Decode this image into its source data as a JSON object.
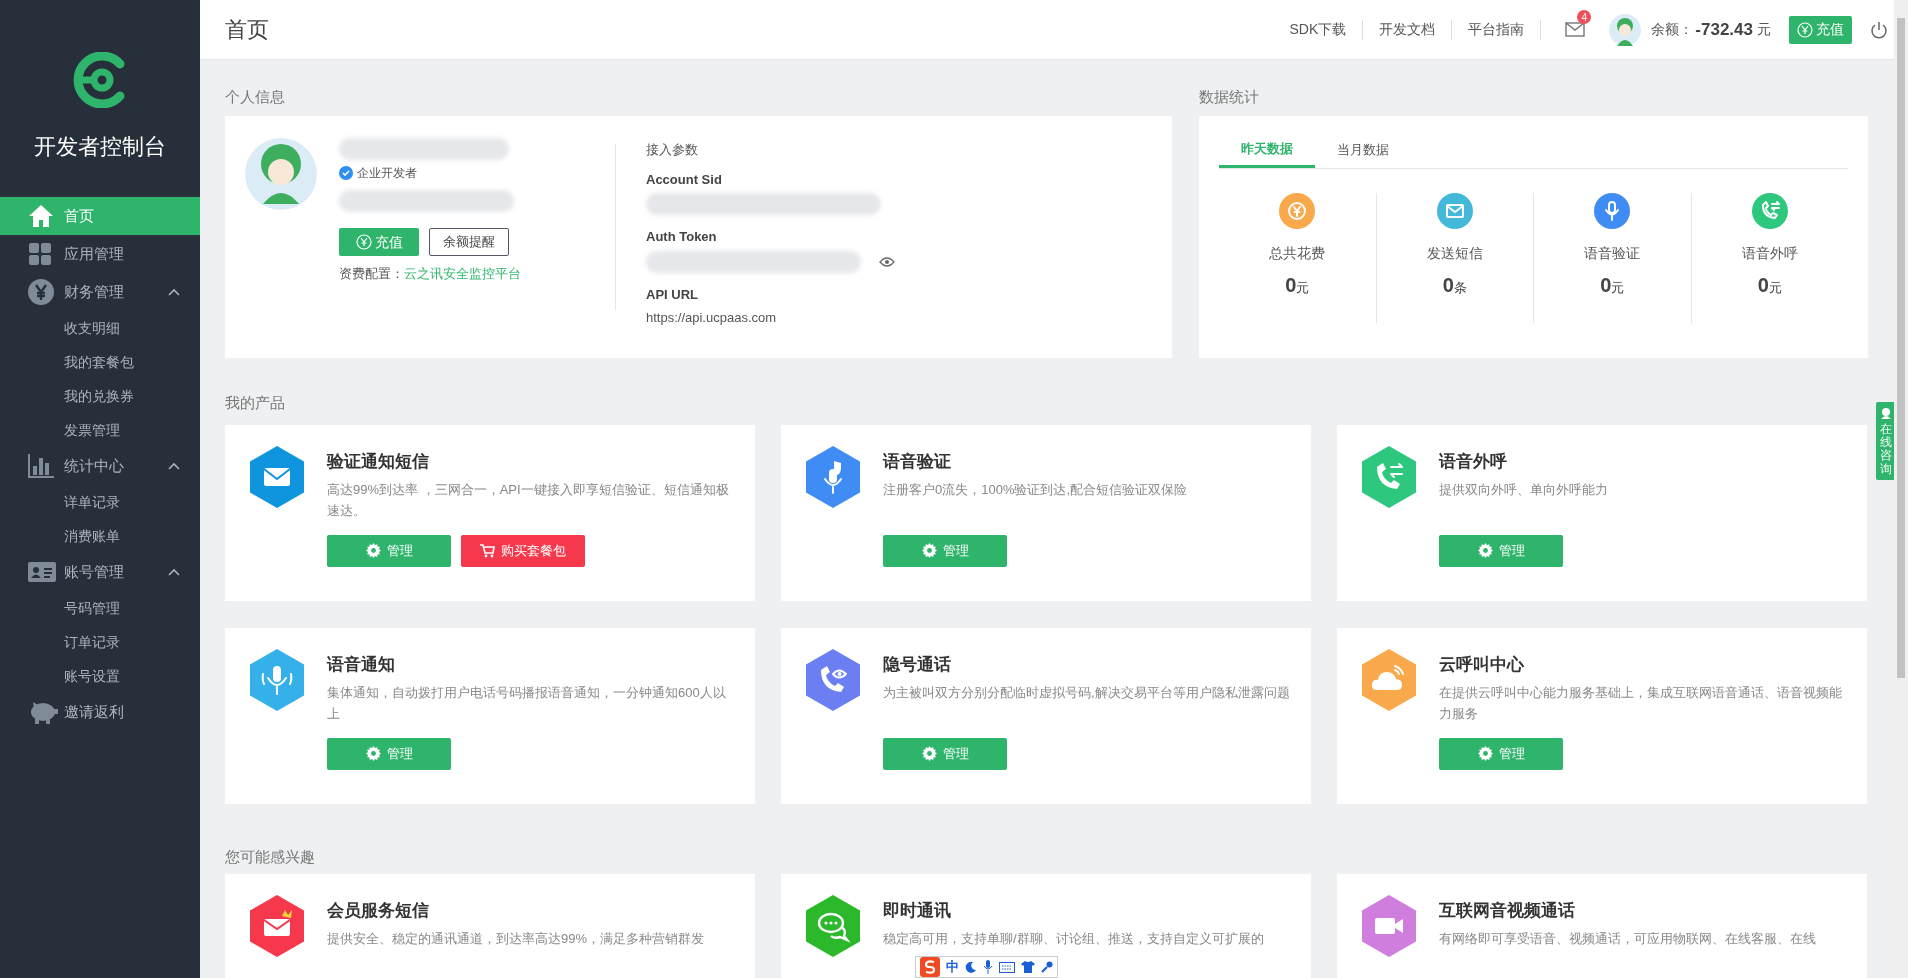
{
  "sidebar": {
    "title": "开发者控制台",
    "items": [
      {
        "label": "首页",
        "selected": true
      },
      {
        "label": "应用管理",
        "selected": false
      },
      {
        "label": "财务管理",
        "selected": false,
        "expanded": true,
        "children": [
          {
            "label": "收支明细"
          },
          {
            "label": "我的套餐包"
          },
          {
            "label": "我的兑换券"
          },
          {
            "label": "发票管理"
          }
        ]
      },
      {
        "label": "统计中心",
        "selected": false,
        "expanded": true,
        "children": [
          {
            "label": "详单记录"
          },
          {
            "label": "消费账单"
          }
        ]
      },
      {
        "label": "账号管理",
        "selected": false,
        "expanded": true,
        "children": [
          {
            "label": "号码管理"
          },
          {
            "label": "订单记录"
          },
          {
            "label": "账号设置"
          }
        ]
      },
      {
        "label": "邀请返利",
        "selected": false
      }
    ]
  },
  "header": {
    "title": "首页",
    "links": [
      "SDK下载",
      "开发文档",
      "平台指南"
    ],
    "mail_count": "4",
    "balance_label": "余额：",
    "balance_value": "-732.43",
    "balance_unit": "元",
    "recharge": "充值"
  },
  "profile": {
    "title": "个人信息",
    "verified": "企业开发者",
    "recharge": "充值",
    "reminder": "余额提醒",
    "fee_label": "资费配置：",
    "fee_link": "云之讯安全监控平台",
    "params_title": "接入参数",
    "params": [
      {
        "label": "Account Sid"
      },
      {
        "label": "Auth Token"
      },
      {
        "label": "API URL",
        "value": "https://api.ucpaas.com"
      }
    ]
  },
  "stats": {
    "title": "数据统计",
    "tabs": [
      {
        "label": "昨天数据",
        "selected": true
      },
      {
        "label": "当月数据",
        "selected": false
      }
    ],
    "items": [
      {
        "label": "总共花费",
        "value": "0",
        "unit": "元",
        "color": "#f9a94b"
      },
      {
        "label": "发送短信",
        "value": "0",
        "unit": "条",
        "color": "#44b8d8"
      },
      {
        "label": "语音验证",
        "value": "0",
        "unit": "元",
        "color": "#3f8cf4"
      },
      {
        "label": "语音外呼",
        "value": "0",
        "unit": "元",
        "color": "#2ec77e"
      }
    ]
  },
  "products": {
    "title": "我的产品",
    "cards": [
      {
        "title": "验证通知短信",
        "description": "高达99%到达率 ，三网合一，API一键接入即享短信验证、短信通知极速达。",
        "color": "#0f94de",
        "buttons": [
          {
            "label": "管理",
            "kind": "manage"
          },
          {
            "label": "购买套餐包",
            "kind": "buy"
          }
        ]
      },
      {
        "title": "语音验证",
        "description": "注册客户0流失，100%验证到达,配合短信验证双保险",
        "color": "#3f8cf4",
        "buttons": [
          {
            "label": "管理",
            "kind": "manage"
          }
        ]
      },
      {
        "title": "语音外呼",
        "description": "提供双向外呼、单向外呼能力",
        "color": "#2ec77e",
        "buttons": [
          {
            "label": "管理",
            "kind": "manage"
          }
        ]
      },
      {
        "title": "语音通知",
        "description": "集体通知，自动拨打用户电话号码播报语音通知，一分钟通知600人以上",
        "color": "#35b0e8",
        "buttons": [
          {
            "label": "管理",
            "kind": "manage"
          }
        ]
      },
      {
        "title": "隐号通话",
        "description": "为主被叫双方分别分配临时虚拟号码,解决交易平台等用户隐私泄露问题",
        "color": "#6c7ff2",
        "buttons": [
          {
            "label": "管理",
            "kind": "manage"
          }
        ]
      },
      {
        "title": "云呼叫中心",
        "description": "在提供云呼叫中心能力服务基础上，集成互联网语音通话、语音视频能力服务",
        "color": "#f9a94b",
        "buttons": [
          {
            "label": "管理",
            "kind": "manage"
          }
        ]
      }
    ]
  },
  "interests": {
    "title": "您可能感兴趣",
    "cards": [
      {
        "title": "会员服务短信",
        "description": "提供安全、稳定的通讯通道，到达率高达99%，满足多种营销群发",
        "color": "#f5384c"
      },
      {
        "title": "即时通讯",
        "description": "稳定高可用，支持单聊/群聊、讨论组、推送，支持自定义可扩展的",
        "color": "#2bb92b"
      },
      {
        "title": "互联网音视频通话",
        "description": "有网络即可享受语音、视频通话，可应用物联网、在线客服、在线",
        "color": "#cf7ede"
      }
    ]
  },
  "online_consult": "在线咨询",
  "ime_toolbar": {
    "mode": "中"
  }
}
